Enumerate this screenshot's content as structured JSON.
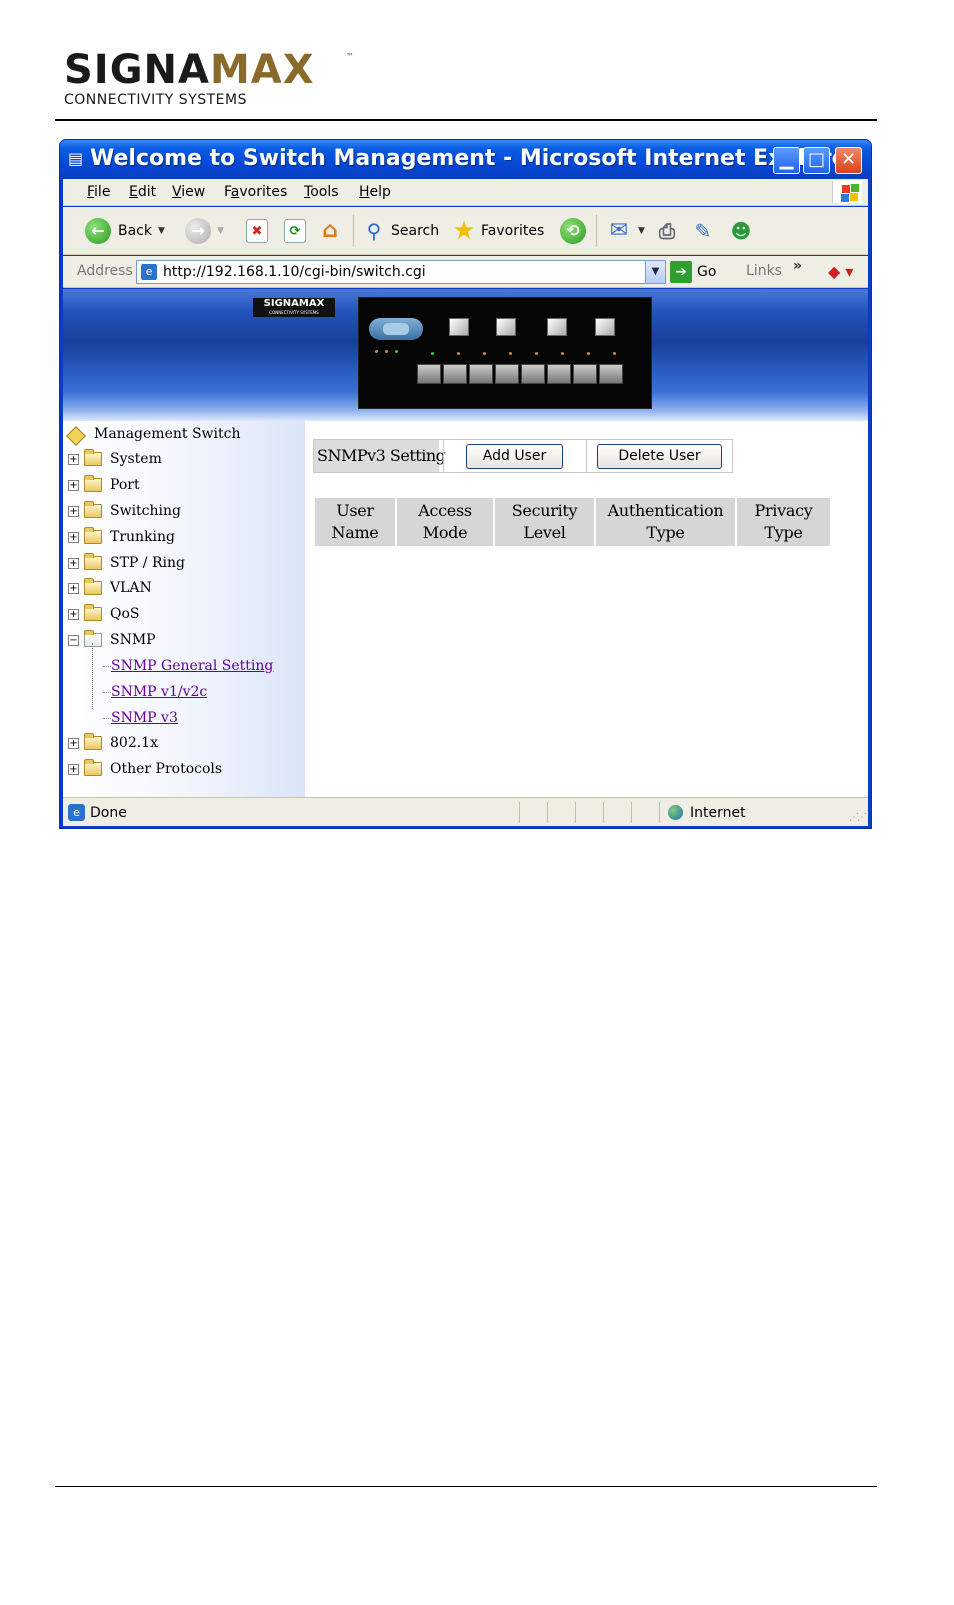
{
  "document": {
    "logo_main_dark": "SIGNA",
    "logo_main_brown": "MAX",
    "logo_tm": "™",
    "logo_sub": "CONNECTIVITY SYSTEMS"
  },
  "window": {
    "title": "Welcome to Switch Management - Microsoft Internet Explorer"
  },
  "menu": {
    "file": {
      "u": "F",
      "rest": "ile"
    },
    "edit": {
      "u": "E",
      "rest": "dit"
    },
    "view": {
      "u": "V",
      "rest": "iew"
    },
    "favorites": {
      "pre": "F",
      "u": "a",
      "rest": "vorites"
    },
    "tools": {
      "u": "T",
      "rest": "ools"
    },
    "help": {
      "u": "H",
      "rest": "elp"
    }
  },
  "toolbar": {
    "back_label": "Back",
    "search_label": "Search",
    "favorites_label": "Favorites"
  },
  "address": {
    "label": "Address",
    "url": "http://192.168.1.10/cgi-bin/switch.cgi",
    "go_label": "Go",
    "links_label": "Links",
    "links_more": "»"
  },
  "banner": {
    "logo_text": "SIGNAMAX",
    "logo_subtext": "CONNECTIVITY SYSTEMS"
  },
  "sidebar": {
    "root_label": "Management Switch",
    "items": [
      {
        "label": "System"
      },
      {
        "label": "Port"
      },
      {
        "label": "Switching"
      },
      {
        "label": "Trunking"
      },
      {
        "label": "STP / Ring"
      },
      {
        "label": "VLAN"
      },
      {
        "label": "QoS"
      },
      {
        "label": "SNMP"
      }
    ],
    "snmp_children": [
      {
        "label": "SNMP General Setting"
      },
      {
        "label": "SNMP v1/v2c"
      },
      {
        "label": "SNMP v3"
      }
    ],
    "items_after": [
      {
        "label": "802.1x"
      },
      {
        "label": "Other Protocols"
      }
    ]
  },
  "content": {
    "setting_label": "SNMPv3 Setting",
    "add_user_label": "Add User",
    "delete_user_label": "Delete User",
    "table_headers": [
      {
        "line1": "User",
        "line2": "Name"
      },
      {
        "line1": "Access",
        "line2": "Mode"
      },
      {
        "line1": "Security",
        "line2": "Level"
      },
      {
        "line1": "Authentication",
        "line2": "Type"
      },
      {
        "line1": "Privacy",
        "line2": "Type"
      }
    ]
  },
  "status": {
    "text": "Done",
    "zone": "Internet"
  },
  "colors": {
    "title_bar": "#0549d6",
    "visited_link": "#660099",
    "table_header_bg": "#d6d6d6"
  }
}
